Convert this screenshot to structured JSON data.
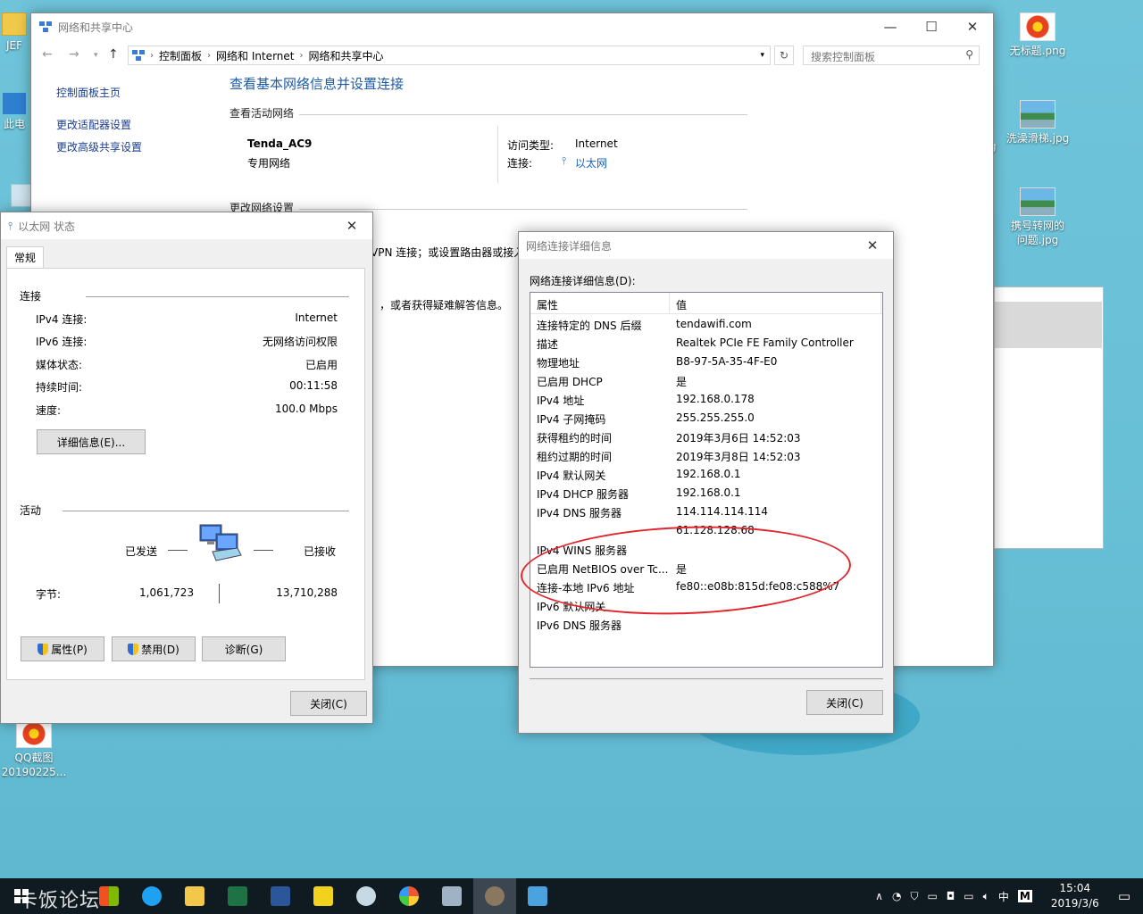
{
  "desktop": {
    "icons": [
      {
        "label": "JEF",
        "kind": "folder"
      },
      {
        "label": "此电",
        "kind": "pc"
      },
      {
        "label": "QQ截图\n20190225...",
        "kind": "flower"
      },
      {
        "label": "无标题.png",
        "kind": "flower"
      },
      {
        "label": "洗澡滑梯.jpg",
        "kind": "landscape"
      },
      {
        "label": "携号转网的\n问题.jpg",
        "kind": "landscape"
      },
      {
        "label": "g",
        "kind": "partial"
      }
    ]
  },
  "main_window": {
    "title": "网络和共享中心",
    "breadcrumbs": [
      "控制面板",
      "网络和 Internet",
      "网络和共享中心"
    ],
    "search_placeholder": "搜索控制面板",
    "left_nav": [
      "控制面板主页",
      "更改适配器设置",
      "更改高级共享设置"
    ],
    "heading": "查看基本网络信息并设置连接",
    "active_network_header": "查看活动网络",
    "network_name": "Tenda_AC9",
    "network_type": "专用网络",
    "access_type_label": "访问类型:",
    "access_type_value": "Internet",
    "connection_label": "连接:",
    "connection_value": "以太网",
    "change_settings_header": "更改网络设置",
    "partial_text_1": "VPN 连接；或设置路由器或接入",
    "partial_text_2": "，或者获得疑难解答信息。"
  },
  "eth_status": {
    "title": "以太网 状态",
    "tab": "常规",
    "connection_group": "连接",
    "rows": [
      {
        "label": "IPv4 连接:",
        "value": "Internet"
      },
      {
        "label": "IPv6 连接:",
        "value": "无网络访问权限"
      },
      {
        "label": "媒体状态:",
        "value": "已启用"
      },
      {
        "label": "持续时间:",
        "value": "00:11:58"
      },
      {
        "label": "速度:",
        "value": "100.0 Mbps"
      }
    ],
    "details_button": "详细信息(E)...",
    "activity_group": "活动",
    "sent_label": "已发送",
    "received_label": "已接收",
    "bytes_label": "字节:",
    "bytes_sent": "1,061,723",
    "bytes_received": "13,710,288",
    "properties_button": "属性(P)",
    "disable_button": "禁用(D)",
    "diagnose_button": "诊断(G)",
    "close_button": "关闭(C)"
  },
  "details": {
    "title": "网络连接详细信息",
    "label": "网络连接详细信息(D):",
    "col_property": "属性",
    "col_value": "值",
    "rows": [
      {
        "p": "连接特定的 DNS 后缀",
        "v": "tendawifi.com"
      },
      {
        "p": "描述",
        "v": "Realtek PCIe FE Family Controller"
      },
      {
        "p": "物理地址",
        "v": "B8-97-5A-35-4F-E0"
      },
      {
        "p": "已启用 DHCP",
        "v": "是"
      },
      {
        "p": "IPv4 地址",
        "v": "192.168.0.178"
      },
      {
        "p": "IPv4 子网掩码",
        "v": "255.255.255.0"
      },
      {
        "p": "获得租约的时间",
        "v": "2019年3月6日 14:52:03"
      },
      {
        "p": "租约过期的时间",
        "v": "2019年3月8日 14:52:03"
      },
      {
        "p": "IPv4 默认网关",
        "v": "192.168.0.1"
      },
      {
        "p": "IPv4 DHCP 服务器",
        "v": "192.168.0.1"
      },
      {
        "p": "IPv4 DNS 服务器",
        "v": "114.114.114.114"
      },
      {
        "p": "",
        "v": "61.128.128.68"
      },
      {
        "p": "IPv4 WINS 服务器",
        "v": ""
      },
      {
        "p": "已启用 NetBIOS over Tc...",
        "v": "是"
      },
      {
        "p": "连接-本地 IPv6 地址",
        "v": "fe80::e08b:815d:fe08:c588%7"
      },
      {
        "p": "IPv6 默认网关",
        "v": ""
      },
      {
        "p": "IPv6 DNS 服务器",
        "v": ""
      }
    ],
    "close_button": "关闭(C)"
  },
  "taskbar": {
    "watermark": "卡饭论坛",
    "ime_label": "中",
    "ime_mode": "M",
    "time": "15:04",
    "date": "2019/3/6"
  }
}
